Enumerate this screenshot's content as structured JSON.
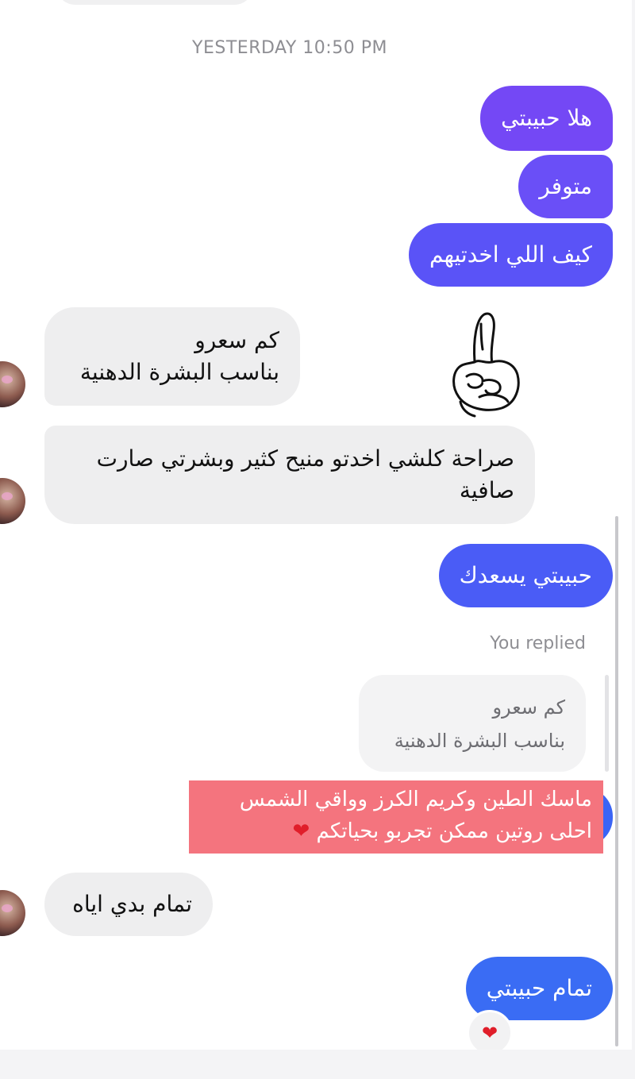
{
  "timestamp": "YESTERDAY 10:50 PM",
  "messages": {
    "out1": "هلا حبيبتي",
    "out2": "متوفر",
    "out3": "كيف اللي اخدتيهم",
    "in1": "كم سعرو\nبناسب البشرة الدهنية",
    "in2": "صراحة كلشي اخدتو منيح كثير وبشرتي صارت\nصافية",
    "out4": "حبيبتي يسعدك",
    "reply_label": "You replied",
    "reply_quote": "كم سعرو\nبناسب البشرة الدهنية",
    "overlay_line1": "ماسك الطين وكريم الكرز وواقي الشمس",
    "overlay_line2": "احلى روتين ممكن تجربو بحياتكم",
    "in3": "تمام بدي اياه",
    "out5": "تمام حبيبتي"
  },
  "reaction": "❤",
  "overlay_emoji": "❤",
  "icons": {
    "sticker": "pointing-finger-sticker-icon",
    "avatar": "contact-avatar",
    "heart": "heart-icon"
  },
  "colors": {
    "out_purple": "#7448f5",
    "out_violet": "#6a4ff7",
    "out_indigo": "#5a53f7",
    "out_blue": "#4a5cf6",
    "out_blue2": "#3a6cf4",
    "in_gray": "#eeeeef",
    "overlay_pink": "#f4747e",
    "heart_red": "#e01e2a"
  }
}
